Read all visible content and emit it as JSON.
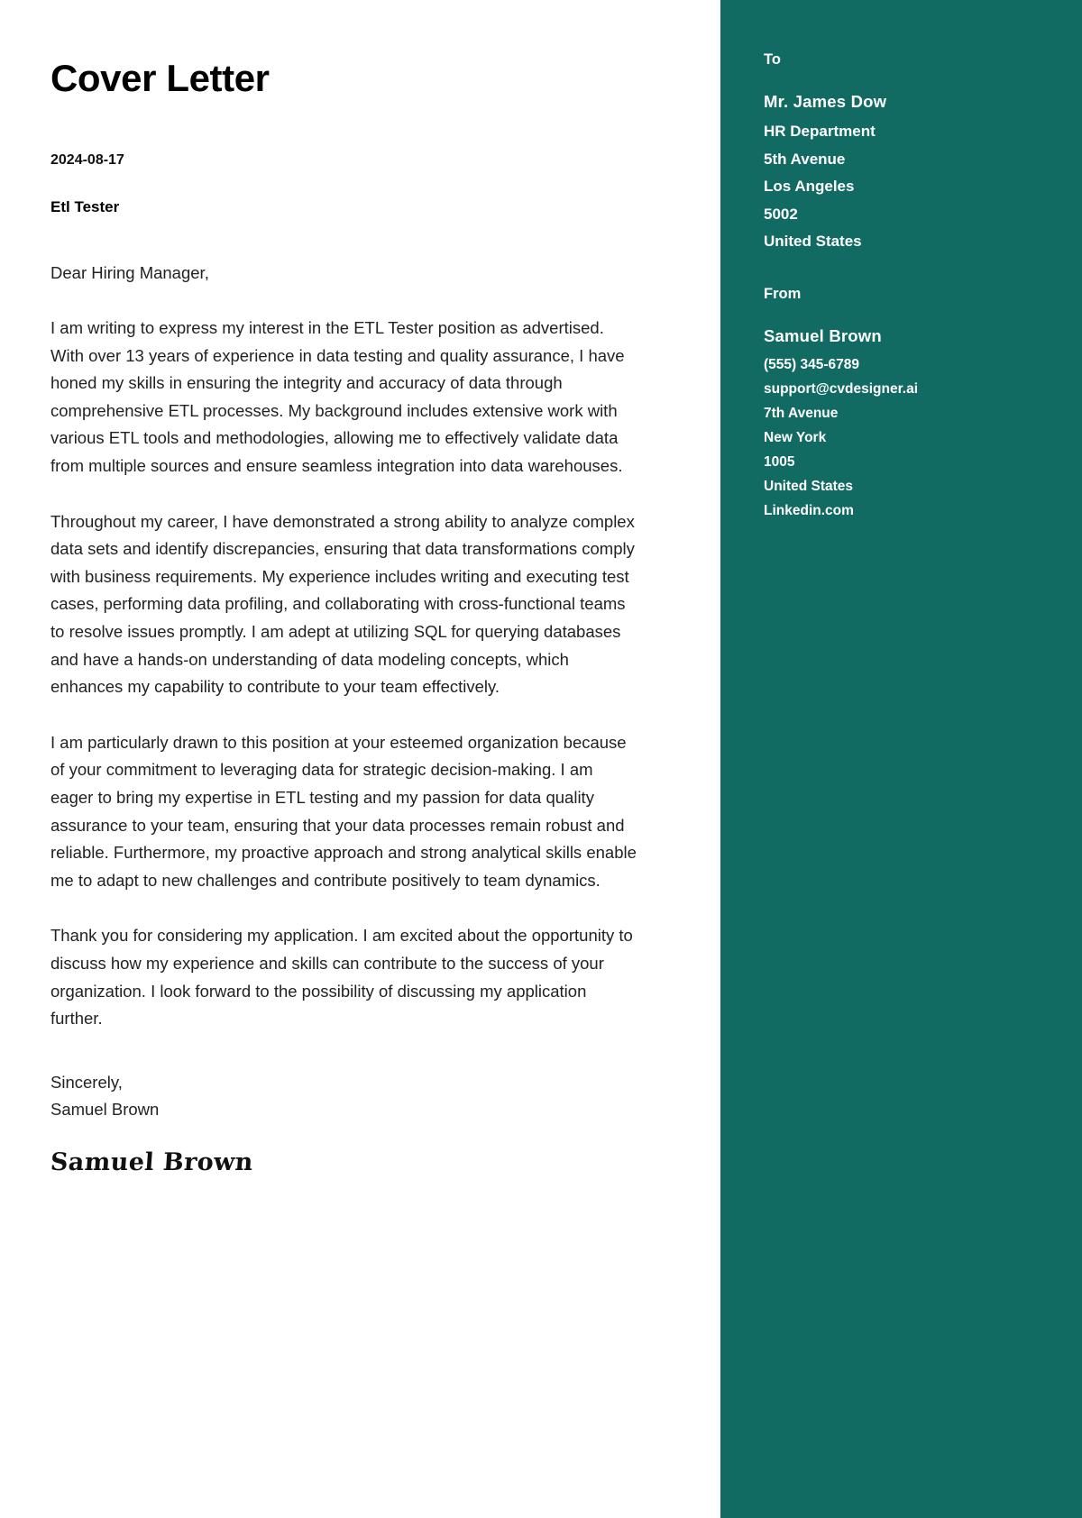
{
  "document": {
    "title": "Cover Letter",
    "date": "2024-08-17",
    "position": "Etl Tester",
    "salutation": "Dear Hiring Manager,",
    "paragraphs": [
      "I am writing to express my interest in the ETL Tester position as advertised. With over 13 years of experience in data testing and quality assurance, I have honed my skills in ensuring the integrity and accuracy of data through comprehensive ETL processes. My background includes extensive work with various ETL tools and methodologies, allowing me to effectively validate data from multiple sources and ensure seamless integration into data warehouses.",
      "Throughout my career, I have demonstrated a strong ability to analyze complex data sets and identify discrepancies, ensuring that data transformations comply with business requirements. My experience includes writing and executing test cases, performing data profiling, and collaborating with cross-functional teams to resolve issues promptly. I am adept at utilizing SQL for querying databases and have a hands-on understanding of data modeling concepts, which enhances my capability to contribute to your team effectively.",
      "I am particularly drawn to this position at your esteemed organization because of your commitment to leveraging data for strategic decision-making. I am eager to bring my expertise in ETL testing and my passion for data quality assurance to your team, ensuring that your data processes remain robust and reliable. Furthermore, my proactive approach and strong analytical skills enable me to adapt to new challenges and contribute positively to team dynamics.",
      "Thank you for considering my application. I am excited about the opportunity to discuss how my experience and skills can contribute to the success of your organization. I look forward to the possibility of discussing my application further."
    ],
    "closing_salutation": "Sincerely,",
    "closing_name": "Samuel Brown",
    "signature": "Samuel Brown"
  },
  "sidebar": {
    "accent_color": "#116b62",
    "text_color": "#ffffff",
    "to": {
      "heading": "To",
      "name": "Mr. James Dow",
      "lines": [
        "HR Department",
        "5th Avenue",
        "Los Angeles",
        "5002",
        "United States"
      ]
    },
    "from": {
      "heading": "From",
      "name": "Samuel Brown",
      "lines": [
        "(555) 345-6789",
        "support@cvdesigner.ai",
        "7th Avenue",
        "New York",
        "1005",
        "United States",
        "Linkedin.com"
      ]
    }
  }
}
